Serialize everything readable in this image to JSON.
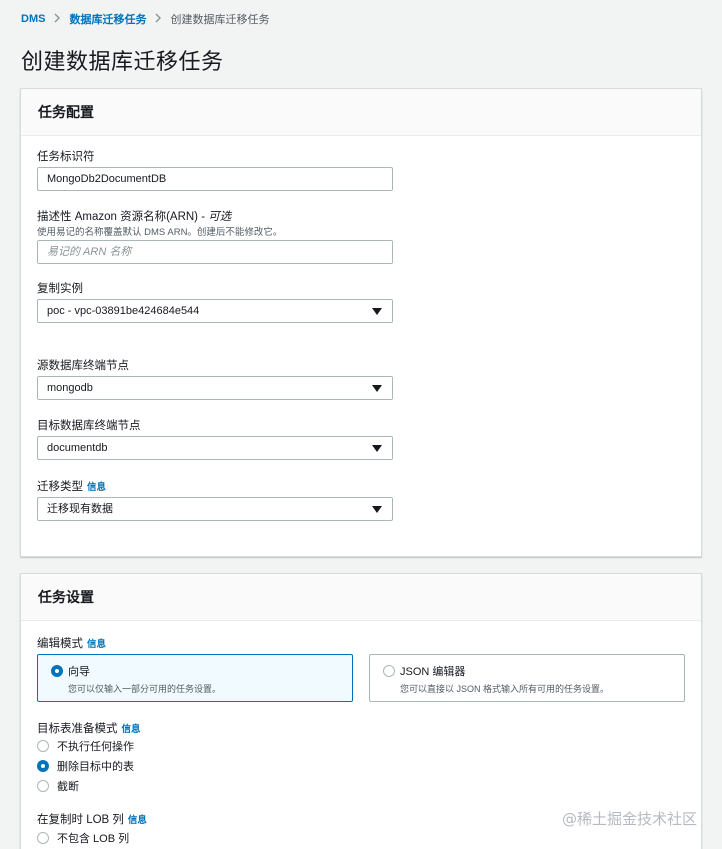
{
  "breadcrumb": {
    "items": [
      "DMS",
      "数据库迁移任务"
    ],
    "separator": ">",
    "current": "创建数据库迁移任务"
  },
  "page": {
    "title": "创建数据库迁移任务"
  },
  "task_config": {
    "title": "任务配置",
    "identifier": {
      "label": "任务标识符",
      "value": "MongoDb2DocumentDB"
    },
    "arn": {
      "label": "描述性 Amazon 资源名称(ARN) - ",
      "optional": "可选",
      "description": "使用易记的名称覆盖默认 DMS ARN。创建后不能修改它。",
      "placeholder": "易记的 ARN 名称"
    },
    "replication_instance": {
      "label": "复制实例",
      "value": "poc - vpc-03891be424684e544"
    },
    "source_endpoint": {
      "label": "源数据库终端节点",
      "value": "mongodb"
    },
    "target_endpoint": {
      "label": "目标数据库终端节点",
      "value": "documentdb"
    },
    "migration_type": {
      "label": "迁移类型",
      "info": "信息",
      "value": "迁移现有数据"
    }
  },
  "task_settings": {
    "title": "任务设置",
    "edit_mode": {
      "label": "编辑模式",
      "info": "信息",
      "options": [
        {
          "title": "向导",
          "desc": "您可以仅输入一部分可用的任务设置。",
          "selected": true
        },
        {
          "title": "JSON 编辑器",
          "desc": "您可以直接以 JSON 格式输入所有可用的任务设置。",
          "selected": false
        }
      ]
    },
    "target_prep": {
      "label": "目标表准备模式",
      "info": "信息",
      "options": [
        {
          "label": "不执行任何操作",
          "selected": false
        },
        {
          "label": "删除目标中的表",
          "selected": true
        },
        {
          "label": "截断",
          "selected": false
        }
      ]
    },
    "lob": {
      "label": "在复制时 LOB 列",
      "info": "信息",
      "options": [
        {
          "label": "不包含 LOB 列",
          "selected": false
        }
      ]
    }
  },
  "watermark": "@稀土掘金技术社区",
  "colors": {
    "link": "#0073bb",
    "page_bg": "#f2f3f3",
    "border": "#aab7b8"
  }
}
